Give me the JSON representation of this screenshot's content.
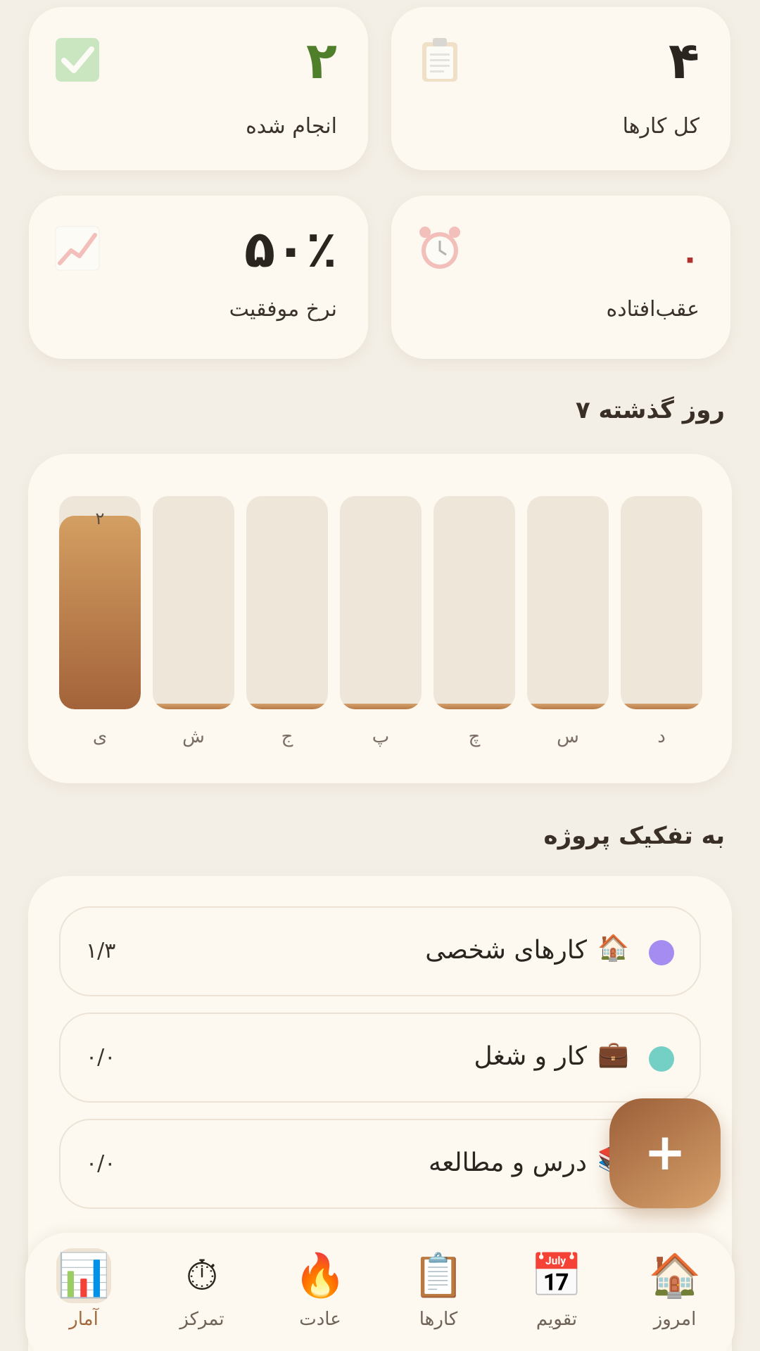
{
  "stats": {
    "total": {
      "value": "۴",
      "label": "کل کارها",
      "icon": "clipboard-icon",
      "color": "#2b2520"
    },
    "done": {
      "value": "۲",
      "label": "انجام شده",
      "icon": "check-icon",
      "color": "#4f7f2b"
    },
    "overdue": {
      "value": "۰",
      "label": "عقب‌افتاده",
      "icon": "alarm-clock-icon",
      "color": "#b0312d"
    },
    "success": {
      "value": "۵۰٪",
      "label": "نرخ موفقیت",
      "icon": "chart-up-icon",
      "color": "#2b2520"
    }
  },
  "last7": {
    "title": "۷ روز گذشته"
  },
  "chart_data": {
    "type": "bar",
    "categories": [
      "د",
      "س",
      "چ",
      "پ",
      "ج",
      "ش",
      "ی"
    ],
    "values": [
      0,
      0,
      0,
      0,
      0,
      0,
      2
    ],
    "value_labels": [
      "",
      "",
      "",
      "",
      "",
      "",
      "۲"
    ],
    "ylim": [
      0,
      2.2
    ],
    "title": "",
    "xlabel": "",
    "ylabel": ""
  },
  "projects": {
    "title": "به تفکیک پروژه",
    "items": [
      {
        "name": "کارهای شخصی",
        "emoji": "🏠",
        "count": "۱/۳",
        "color": "#a58cf0"
      },
      {
        "name": "کار و شغل",
        "emoji": "💼",
        "count": "۰/۰",
        "color": "#74d0c4"
      },
      {
        "name": "درس و مطالعه",
        "emoji": "📚",
        "count": "۰/۰",
        "color": "#e0b36e"
      }
    ]
  },
  "fab": {
    "label": "+"
  },
  "nav": {
    "items": [
      {
        "label": "امروز",
        "icon": "🏠"
      },
      {
        "label": "تقویم",
        "icon": "📅"
      },
      {
        "label": "کارها",
        "icon": "📋"
      },
      {
        "label": "عادت",
        "icon": "🔥"
      },
      {
        "label": "تمرکز",
        "icon": "⏱"
      },
      {
        "label": "آمار",
        "icon": "📊"
      }
    ]
  }
}
